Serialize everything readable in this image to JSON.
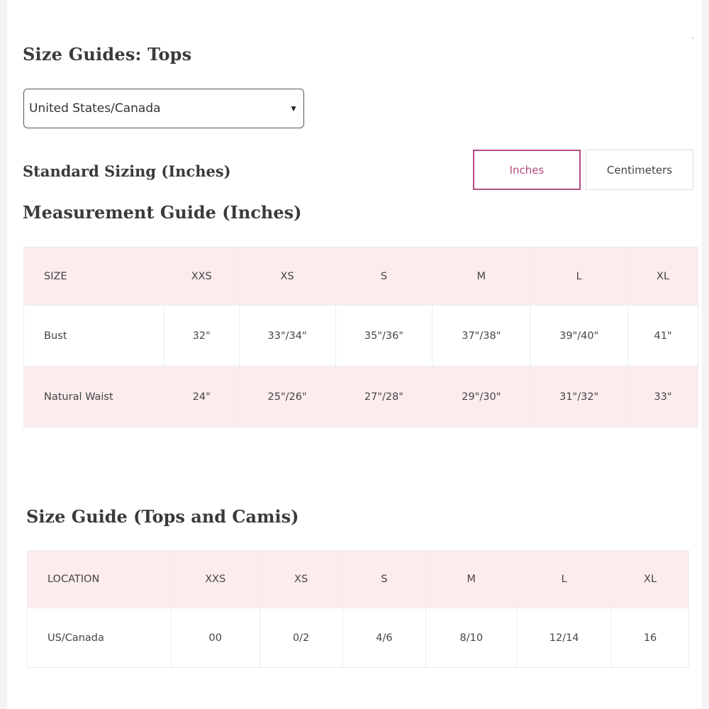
{
  "header": {
    "title": "Size Guides: Tops"
  },
  "region_select": {
    "selected": "United States/Canada"
  },
  "standard_sizing": "Standard Sizing (Inches)",
  "units": {
    "inches_label": "Inches",
    "cm_label": "Centimeters",
    "active": "Inches",
    "active_color": "#b44d7e"
  },
  "measurement_guide": {
    "title": "Measurement Guide (Inches)",
    "header": [
      "SIZE",
      "XXS",
      "XS",
      "S",
      "M",
      "L",
      "XL"
    ],
    "rows": [
      [
        "Bust",
        "32\"",
        "33\"/34\"",
        "35\"/36\"",
        "37\"/38\"",
        "39\"/40\"",
        "41\""
      ],
      [
        "Natural Waist",
        "24\"",
        "25\"/26\"",
        "27\"/28\"",
        "29\"/30\"",
        "31\"/32\"",
        "33\""
      ]
    ]
  },
  "size_guide": {
    "title": "Size Guide (Tops and Camis)",
    "header": [
      "LOCATION",
      "XXS",
      "XS",
      "S",
      "M",
      "L",
      "XL"
    ],
    "rows": [
      [
        "US/Canada",
        "00",
        "0/2",
        "4/6",
        "8/10",
        "12/14",
        "16"
      ]
    ]
  },
  "colors": {
    "header_row_bg": "#fcecee",
    "border": "#ececec"
  }
}
